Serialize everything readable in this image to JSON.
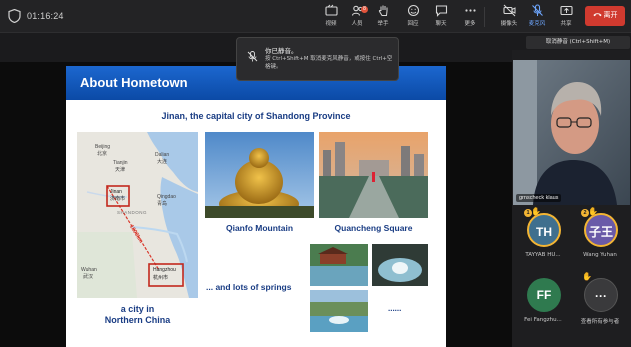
{
  "topbar": {
    "timer": "01:16:24",
    "buttons": [
      {
        "label": "视频",
        "icon": "video-icon"
      },
      {
        "label": "人员",
        "icon": "people-icon",
        "badge": "8"
      },
      {
        "label": "举手",
        "icon": "raise-hand-icon"
      },
      {
        "label": "回应",
        "icon": "reaction-icon"
      },
      {
        "label": "聊天",
        "icon": "chat-icon"
      },
      {
        "label": "更多",
        "icon": "more-icon"
      },
      {
        "label": "摄像头",
        "icon": "camera-off-icon"
      },
      {
        "label": "麦克风",
        "icon": "mic-off-icon"
      },
      {
        "label": "共享",
        "icon": "share-icon"
      }
    ],
    "leave_label": "离开",
    "colors": {
      "bar": "#232325",
      "leave": "#d03a2f",
      "accent": "#6ea7ff"
    }
  },
  "mute_tooltip": {
    "title": "你已静音。",
    "body": "按 Ctrl+Shift+M 取消麦克风静音，或按住 Ctrl+空格键。"
  },
  "mic_shortcut_chip": "取消静音 (Ctrl+Shift+M)",
  "slide": {
    "header": "About Hometown",
    "subtitle": "Jinan, the capital city of Shandong Province",
    "map": {
      "labels": [
        "Beijing",
        "北京",
        "Dalian",
        "大连",
        "Tianjin",
        "天津",
        "Qingdao",
        "青岛",
        "Jinan",
        "济南市",
        "SHANDONG",
        "Wuhan",
        "武汉",
        "Hangzhou",
        "杭州市"
      ],
      "distance_label": "1000km"
    },
    "map_caption": "a city in\nNorthern China",
    "photos": [
      {
        "caption": "Qianfo Mountain"
      },
      {
        "caption": "Quancheng Square"
      }
    ],
    "springs_caption": "... and lots of springs",
    "ellipsis": "......"
  },
  "participants": {
    "video_name": "grnscheck klaus",
    "tiles": [
      {
        "initials": "TH",
        "name": "TAYYAB HU...",
        "number": "1",
        "color": "#3f6f8e",
        "hand": true
      },
      {
        "initials": "子王",
        "name": "Wang Yuhan",
        "number": "2",
        "color": "#6a5aa8",
        "hand": true
      },
      {
        "initials": "FF",
        "name": "Fei Fangzhu...",
        "color": "#2f7a4f",
        "hand": false
      },
      {
        "initials": "···",
        "name": "查看所有参与者",
        "color": "#3a3a3c",
        "hand": true
      }
    ]
  }
}
